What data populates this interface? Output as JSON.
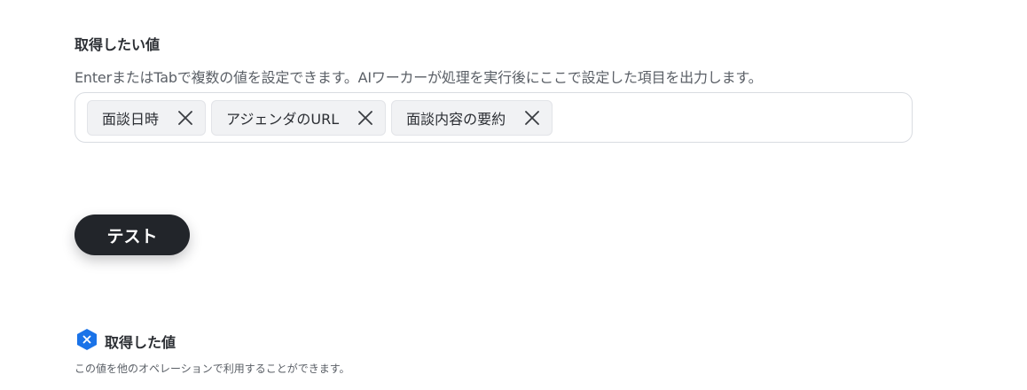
{
  "field": {
    "label": "取得したい値",
    "description": "EnterまたはTabで複数の値を設定できます。AIワーカーが処理を実行後にここで設定した項目を出力します。",
    "tags": [
      {
        "label": "面談日時",
        "remove_icon": "close-icon"
      },
      {
        "label": "アジェンダのURL",
        "remove_icon": "close-icon"
      },
      {
        "label": "面談内容の要約",
        "remove_icon": "close-icon"
      }
    ]
  },
  "test_button": {
    "label": "テスト"
  },
  "result": {
    "icon": "variable-hexagon-icon",
    "icon_color": "#1a73e8",
    "title": "取得した値",
    "description": "この値を他のオペレーションで利用することができます。"
  },
  "colors": {
    "button_bg": "#22252a",
    "tag_bg": "#f1f2f4",
    "border": "#d9dce1",
    "accent": "#1a73e8"
  }
}
